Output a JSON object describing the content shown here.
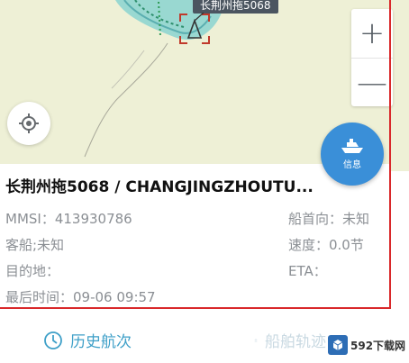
{
  "map": {
    "ship_label": "长荆州拖5068",
    "zoom_in": "+",
    "zoom_out": "—",
    "info_button_label": "信息",
    "icons": [
      "crosshair-icon",
      "ship-icon"
    ],
    "colors": {
      "land": "#eef0d6",
      "water": "#8ad3d0",
      "accent": "#3a8fd8"
    }
  },
  "panel": {
    "title": "长荆州拖5068 / CHANGJINGZHOUTU...",
    "mmsi": "MMSI：413930786",
    "heading": "船首向：未知",
    "ship_type": "客船;未知",
    "speed": "速度：0.0节",
    "destination": "目的地：",
    "eta": "ETA：",
    "last_time": "最后时间：09-06 09:57",
    "border_color": "#d9282a"
  },
  "tabs": {
    "history": "历史航次",
    "track": "船舶轨迹"
  },
  "watermark": {
    "text": "592下载网",
    "logo": "5"
  }
}
